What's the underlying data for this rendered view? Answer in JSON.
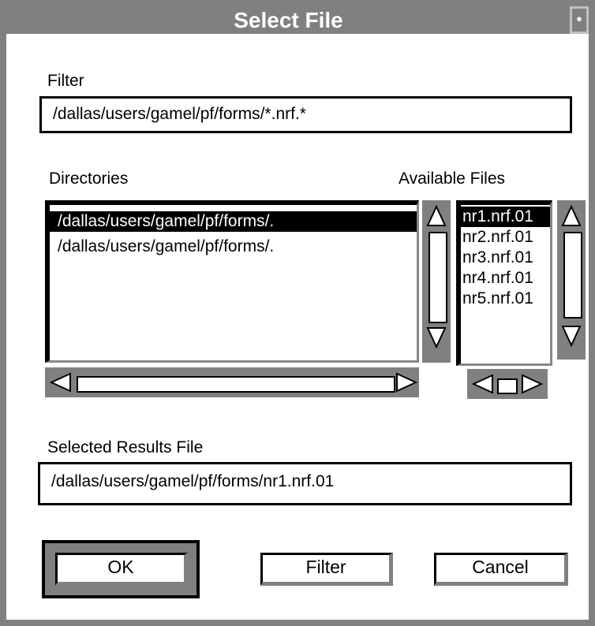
{
  "title": "Select File",
  "title_menu_glyph": "•",
  "filter": {
    "label": "Filter",
    "value": "/dallas/users/gamel/pf/forms/*.nrf.*"
  },
  "directories": {
    "label": "Directories",
    "items": [
      {
        "text": "/dallas/users/gamel/pf/forms/.",
        "selected": true
      },
      {
        "text": "/dallas/users/gamel/pf/forms/.",
        "selected": false
      }
    ]
  },
  "files": {
    "label": "Available Files",
    "items": [
      {
        "text": "nr1.nrf.01",
        "selected": true
      },
      {
        "text": "nr2.nrf.01",
        "selected": false
      },
      {
        "text": "nr3.nrf.01",
        "selected": false
      },
      {
        "text": "nr4.nrf.01",
        "selected": false
      },
      {
        "text": "nr5.nrf.01",
        "selected": false
      }
    ]
  },
  "selection": {
    "label": "Selected Results File",
    "value": "/dallas/users/gamel/pf/forms/nr1.nrf.01"
  },
  "buttons": {
    "ok": "OK",
    "filter": "Filter",
    "cancel": "Cancel"
  }
}
